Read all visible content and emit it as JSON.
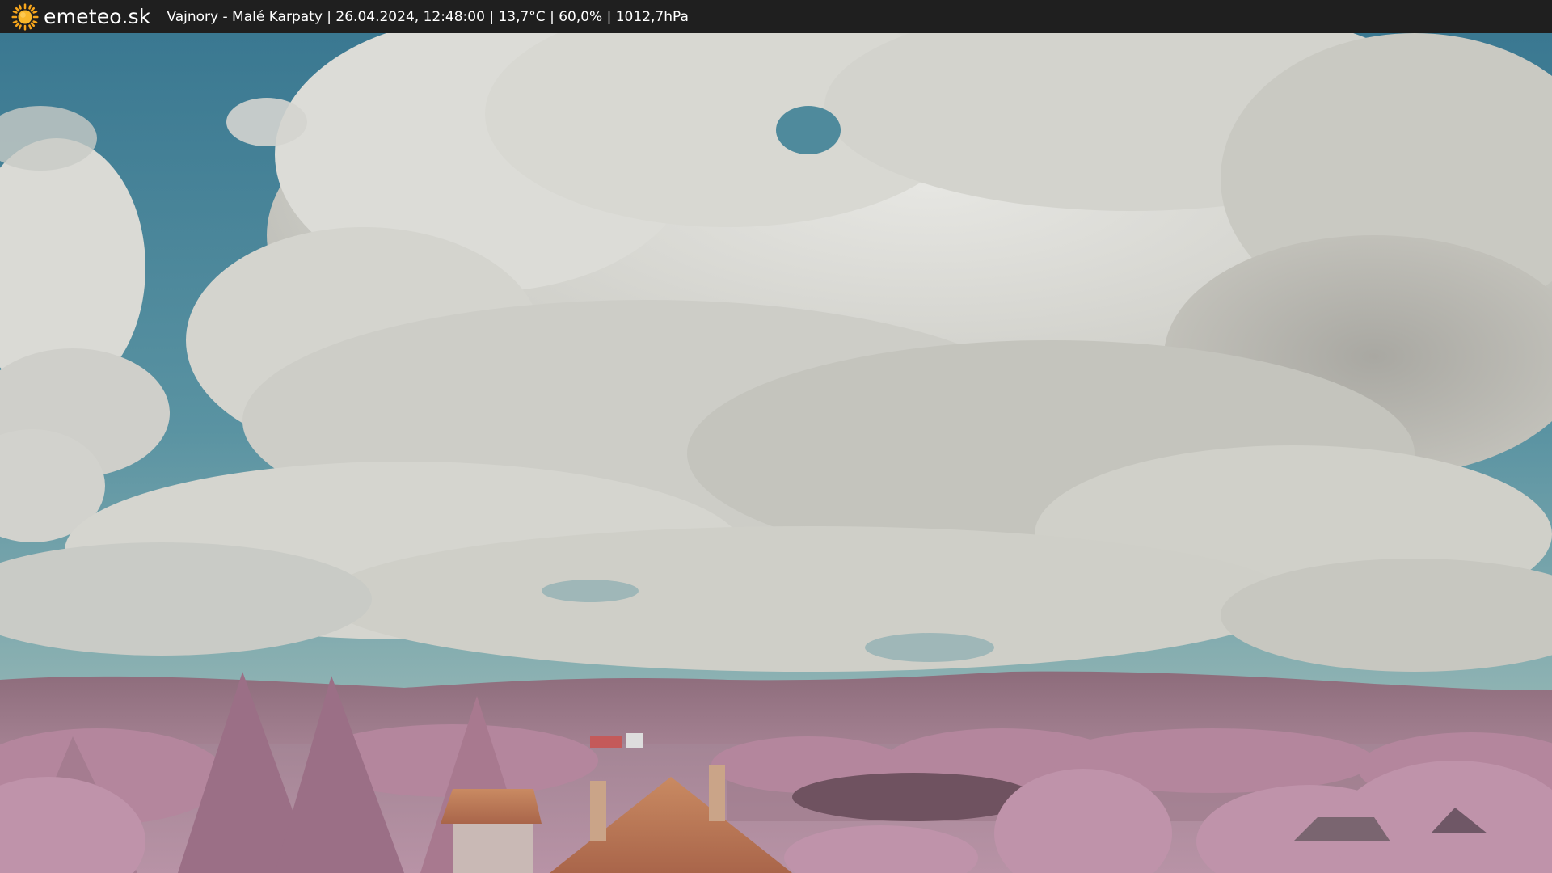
{
  "header": {
    "brand": "emeteo.sk",
    "caption": "Vajnory - Malé Karpaty | 26.04.2024, 12:48:00 | 13,7°C | 60,0% | 1012,7hPa"
  },
  "colors": {
    "bar_background": "#1f1f1f",
    "sun_accent": "#f6a51c",
    "sky_blue": "#3e7f97",
    "cloud": "#d9d9d4",
    "foliage_ir": "#b98ea6",
    "roof": "#c77a55"
  },
  "icons": {
    "logo": "sun-icon"
  },
  "image": {
    "description_type": "webcam-infrared-landscape"
  }
}
